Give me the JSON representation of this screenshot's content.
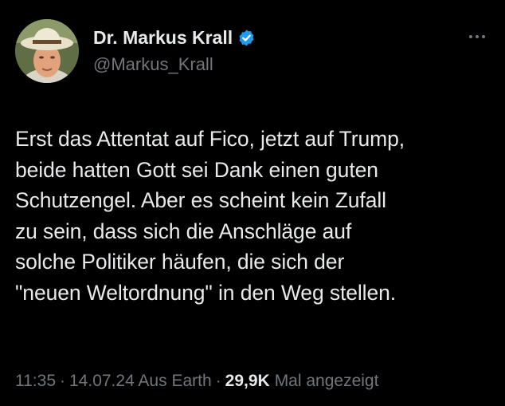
{
  "author": {
    "display_name": "Dr. Markus Krall",
    "handle": "@Markus_Krall",
    "verified": true,
    "verified_color": "#1d9bf0"
  },
  "tweet": {
    "lines": [
      "Erst das Attentat auf Fico, jetzt auf Trump,",
      "beide hatten Gott sei Dank einen guten",
      "Schutzengel. Aber es scheint kein Zufall",
      "zu sein, dass sich die Anschläge auf",
      "solche Politiker häufen, die sich der",
      "\"neuen Weltordnung\" in den Weg stellen."
    ]
  },
  "meta": {
    "time": "11:35",
    "separator": "·",
    "date_location": "14.07.24 Aus Earth",
    "views_count": "29,9K",
    "views_label": "Mal angezeigt"
  },
  "icons": {
    "more": "more-horizontal-icon",
    "verified": "verified-badge-icon"
  },
  "colors": {
    "background": "#000000",
    "text_primary": "#e7e9ea",
    "text_secondary": "#71767b"
  }
}
